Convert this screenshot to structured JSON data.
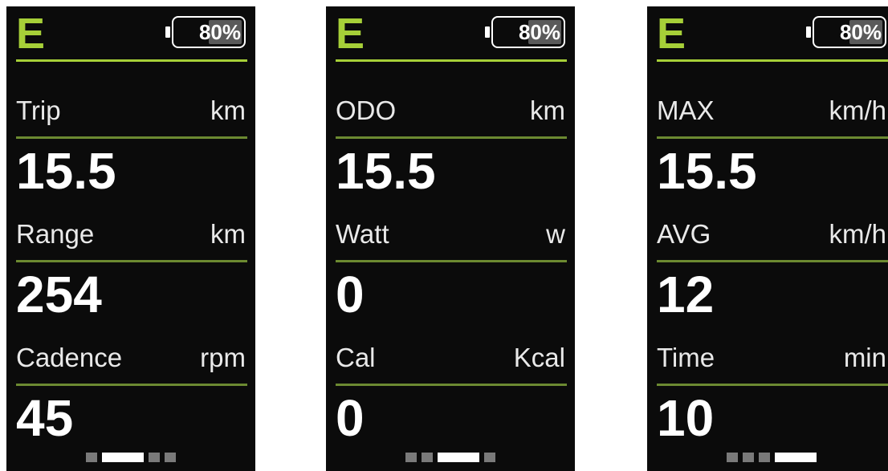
{
  "colors": {
    "accent": "#a6cf38",
    "divider": "#6c8a31",
    "background": "#0b0b0b",
    "battery_fill": "#5a5a5a"
  },
  "screens": [
    {
      "mode": "E",
      "battery": {
        "text": "80%",
        "level": 0.8
      },
      "rows": [
        {
          "label": "Trip",
          "unit": "km",
          "value": "15.5"
        },
        {
          "label": "Range",
          "unit": "km",
          "value": "254"
        },
        {
          "label": "Cadence",
          "unit": "rpm",
          "value": "45"
        }
      ],
      "page_total": 4,
      "page_active": 2
    },
    {
      "mode": "E",
      "battery": {
        "text": "80%",
        "level": 0.8
      },
      "rows": [
        {
          "label": "ODO",
          "unit": "km",
          "value": "15.5"
        },
        {
          "label": "Watt",
          "unit": "w",
          "value": "0"
        },
        {
          "label": "Cal",
          "unit": "Kcal",
          "value": "0"
        }
      ],
      "page_total": 4,
      "page_active": 3
    },
    {
      "mode": "E",
      "battery": {
        "text": "80%",
        "level": 0.8
      },
      "rows": [
        {
          "label": "MAX",
          "unit": "km/h",
          "value": "15.5"
        },
        {
          "label": "AVG",
          "unit": "km/h",
          "value": "12"
        },
        {
          "label": "Time",
          "unit": "min",
          "value": "10"
        }
      ],
      "page_total": 4,
      "page_active": 4
    }
  ]
}
